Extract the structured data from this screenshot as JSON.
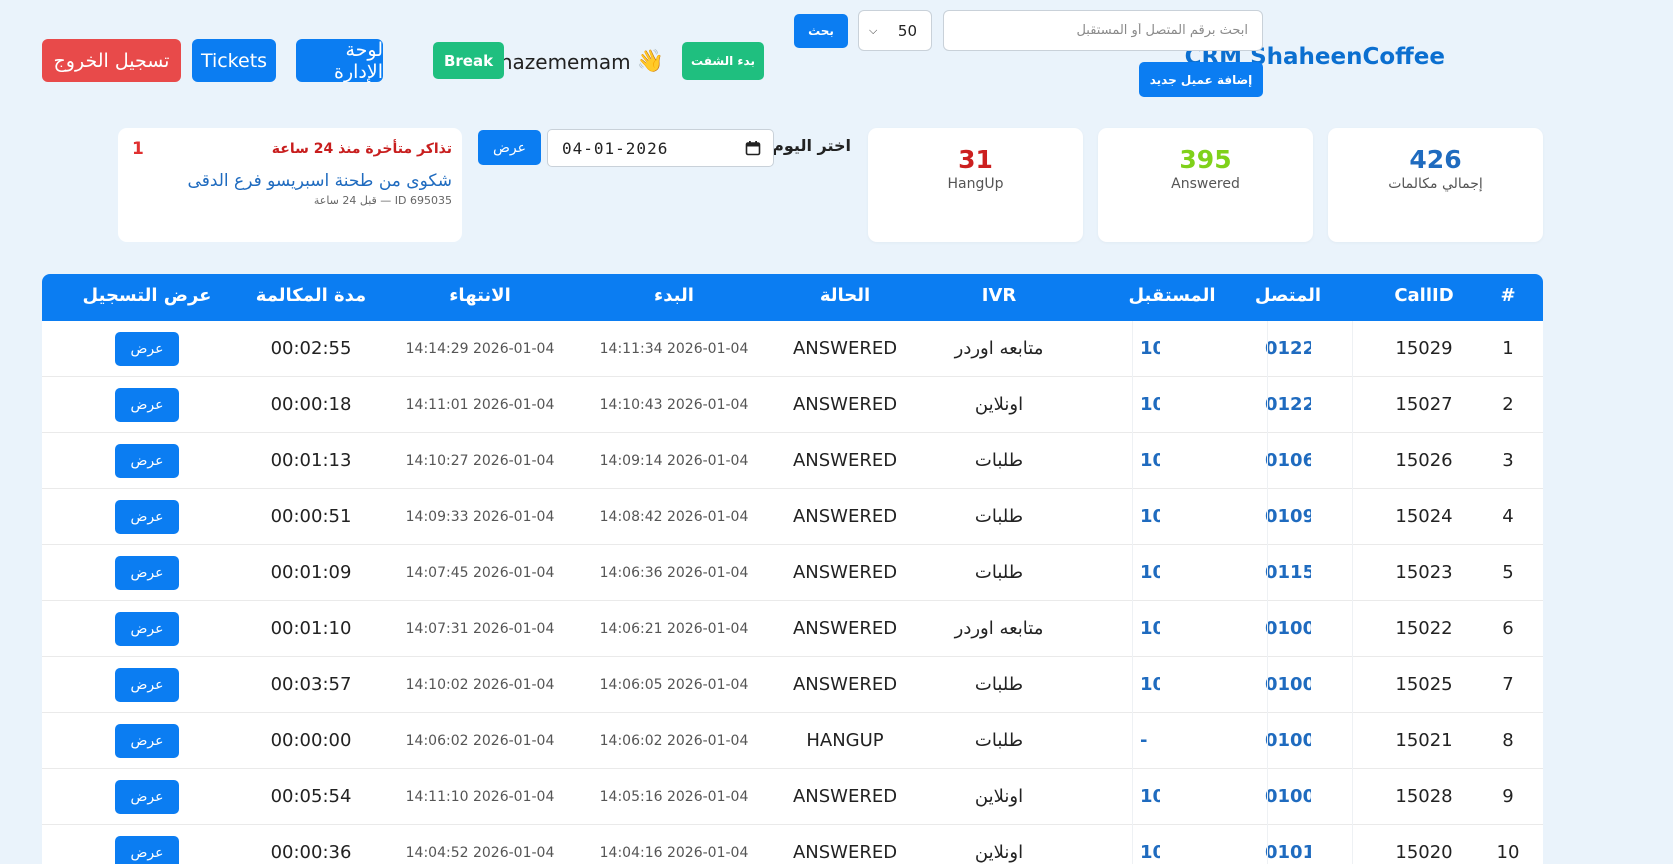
{
  "header": {
    "brand": "CRM ShaheenCoffee",
    "search_placeholder": "ابحث برقم المتصل أو المستقبل",
    "add_client_label": "إضافة عميل جديد",
    "page_size": "50",
    "search_label": "بحث",
    "start_shift_label": "بدء الشفت",
    "username": "hazememam",
    "wave_emoji": "👋",
    "break_label": "Break",
    "admin_label": "لوحة الإدارة",
    "tickets_label": "Tickets",
    "logout_label": "تسجيل الخروج"
  },
  "stats": {
    "total": {
      "value": "426",
      "label": "إجمالي مكالمات",
      "color": "#1f6bbf"
    },
    "answered": {
      "value": "395",
      "label": "Answered",
      "color": "#7fd11a"
    },
    "hangup": {
      "value": "31",
      "label": "HangUp",
      "color": "#cc1f1f"
    }
  },
  "date_filter": {
    "label": "اختر اليوم:",
    "value": "04-01-2026",
    "show_label": "عرض"
  },
  "late_tickets": {
    "title": "تذاكر متأخرة منذ 24 ساعة",
    "count": "1",
    "ticket_title": "شكوى من طحنة اسبريسو فرع الدقى",
    "ticket_meta": "ID 695035 — قبل 24 ساعة"
  },
  "table": {
    "headers": {
      "index": "#",
      "callid": "CallID",
      "caller": "المتصل",
      "receiver": "المستقبل",
      "ivr": "IVR",
      "status": "الحالة",
      "start": "البدء",
      "end": "الانتهاء",
      "duration": "مدة المكالمة",
      "recording": "عرض التسجيل"
    },
    "record_button_label": "عرض",
    "rows": [
      {
        "index": "1",
        "callid": "15029",
        "caller": "0122",
        "receiver": "10",
        "ivr": "متابعه اوردر",
        "status": "ANSWERED",
        "start": "2026-01-04 14:11:34",
        "end": "2026-01-04 14:14:29",
        "duration": "00:02:55"
      },
      {
        "index": "2",
        "callid": "15027",
        "caller": "0122",
        "receiver": "10",
        "ivr": "اونلاين",
        "status": "ANSWERED",
        "start": "2026-01-04 14:10:43",
        "end": "2026-01-04 14:11:01",
        "duration": "00:00:18"
      },
      {
        "index": "3",
        "callid": "15026",
        "caller": "0106",
        "receiver": "10",
        "ivr": "طلبات",
        "status": "ANSWERED",
        "start": "2026-01-04 14:09:14",
        "end": "2026-01-04 14:10:27",
        "duration": "00:01:13"
      },
      {
        "index": "4",
        "callid": "15024",
        "caller": "0109",
        "receiver": "10",
        "ivr": "طلبات",
        "status": "ANSWERED",
        "start": "2026-01-04 14:08:42",
        "end": "2026-01-04 14:09:33",
        "duration": "00:00:51"
      },
      {
        "index": "5",
        "callid": "15023",
        "caller": "0115",
        "receiver": "10",
        "ivr": "طلبات",
        "status": "ANSWERED",
        "start": "2026-01-04 14:06:36",
        "end": "2026-01-04 14:07:45",
        "duration": "00:01:09"
      },
      {
        "index": "6",
        "callid": "15022",
        "caller": "0100",
        "receiver": "10",
        "ivr": "متابعه اوردر",
        "status": "ANSWERED",
        "start": "2026-01-04 14:06:21",
        "end": "2026-01-04 14:07:31",
        "duration": "00:01:10"
      },
      {
        "index": "7",
        "callid": "15025",
        "caller": "0100",
        "receiver": "10",
        "ivr": "طلبات",
        "status": "ANSWERED",
        "start": "2026-01-04 14:06:05",
        "end": "2026-01-04 14:10:02",
        "duration": "00:03:57"
      },
      {
        "index": "8",
        "callid": "15021",
        "caller": "0100",
        "receiver": "-",
        "ivr": "طلبات",
        "status": "HANGUP",
        "start": "2026-01-04 14:06:02",
        "end": "2026-01-04 14:06:02",
        "duration": "00:00:00"
      },
      {
        "index": "9",
        "callid": "15028",
        "caller": "0100",
        "receiver": "10",
        "ivr": "اونلاين",
        "status": "ANSWERED",
        "start": "2026-01-04 14:05:16",
        "end": "2026-01-04 14:11:10",
        "duration": "00:05:54"
      },
      {
        "index": "10",
        "callid": "15020",
        "caller": "0101",
        "receiver": "10",
        "ivr": "اونلاين",
        "status": "ANSWERED",
        "start": "2026-01-04 14:04:16",
        "end": "2026-01-04 14:04:52",
        "duration": "00:00:36"
      }
    ]
  }
}
